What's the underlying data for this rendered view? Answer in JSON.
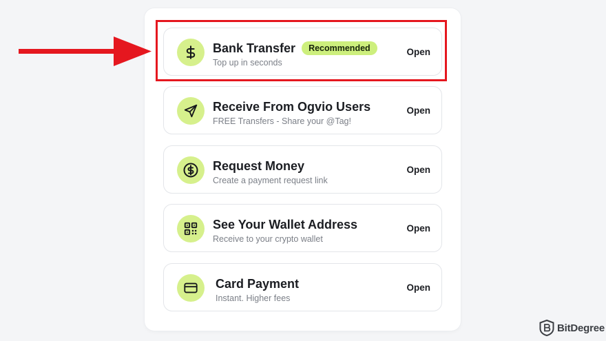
{
  "options": [
    {
      "icon": "dollar-icon",
      "title": "Bank Transfer",
      "badge": "Recommended",
      "subtitle": "Top up in seconds",
      "action": "Open"
    },
    {
      "icon": "send-icon",
      "title": "Receive From Ogvio Users",
      "subtitle": "FREE Transfers - Share your @Tag!",
      "action": "Open"
    },
    {
      "icon": "dollar-circle-icon",
      "title": "Request Money",
      "subtitle": "Create a payment request link",
      "action": "Open"
    },
    {
      "icon": "qr-code-icon",
      "title": "See Your Wallet Address",
      "subtitle": "Receive to your crypto wallet",
      "action": "Open"
    },
    {
      "icon": "credit-card-icon",
      "title": "Card Payment",
      "subtitle": "Instant. Higher fees",
      "action": "Open"
    }
  ],
  "watermark": {
    "text": "BitDegree"
  },
  "colors": {
    "icon_background": "#d6f08c",
    "badge_background": "#cdef7d",
    "highlight": "#e5171f",
    "page_background": "#f4f5f7"
  }
}
